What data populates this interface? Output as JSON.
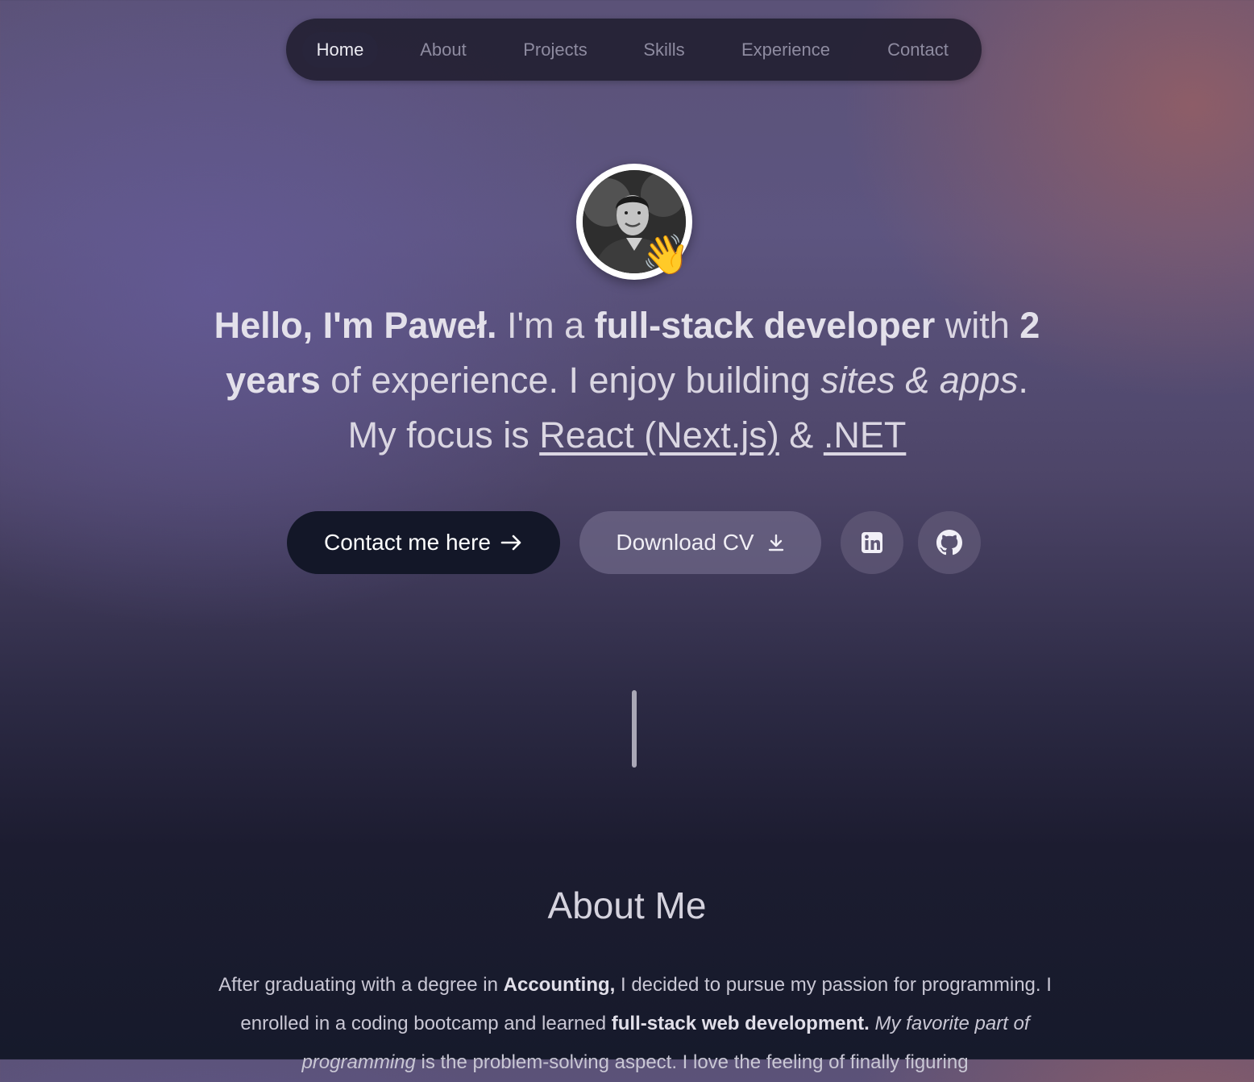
{
  "nav": {
    "items": [
      {
        "label": "Home",
        "active": true
      },
      {
        "label": "About",
        "active": false
      },
      {
        "label": "Projects",
        "active": false
      },
      {
        "label": "Skills",
        "active": false
      },
      {
        "label": "Experience",
        "active": false
      },
      {
        "label": "Contact",
        "active": false
      }
    ]
  },
  "hero": {
    "wave_emoji": "👋",
    "intro": {
      "greeting": "Hello, I'm Paweł.",
      "t1": " I'm a ",
      "role": "full-stack developer",
      "t2": " with ",
      "years": "2 years",
      "t3": " of experience. I enjoy building ",
      "sites": "sites & apps",
      "t4": ". My focus is ",
      "tech1": "React (Next.js)",
      "t5": " & ",
      "tech2": ".NET"
    },
    "buttons": {
      "contact": "Contact me here",
      "cv": "Download CV",
      "linkedin_icon": "linkedin-icon",
      "github_icon": "github-icon"
    }
  },
  "about": {
    "title": "About Me",
    "p1": "After graduating with a degree in ",
    "accounting": "Accounting,",
    "p2": " I decided to pursue my passion for programming. I enrolled in a coding bootcamp and learned ",
    "fullstack": "full-stack web development.",
    "p3": " ",
    "fav": "My favorite part of programming",
    "p4": " is the problem-solving aspect. I love the feeling of finally figuring"
  },
  "colors": {
    "nav_bg": "#1c1a2a",
    "primary_button": "#131728",
    "secondary_button": "#6e6787"
  }
}
